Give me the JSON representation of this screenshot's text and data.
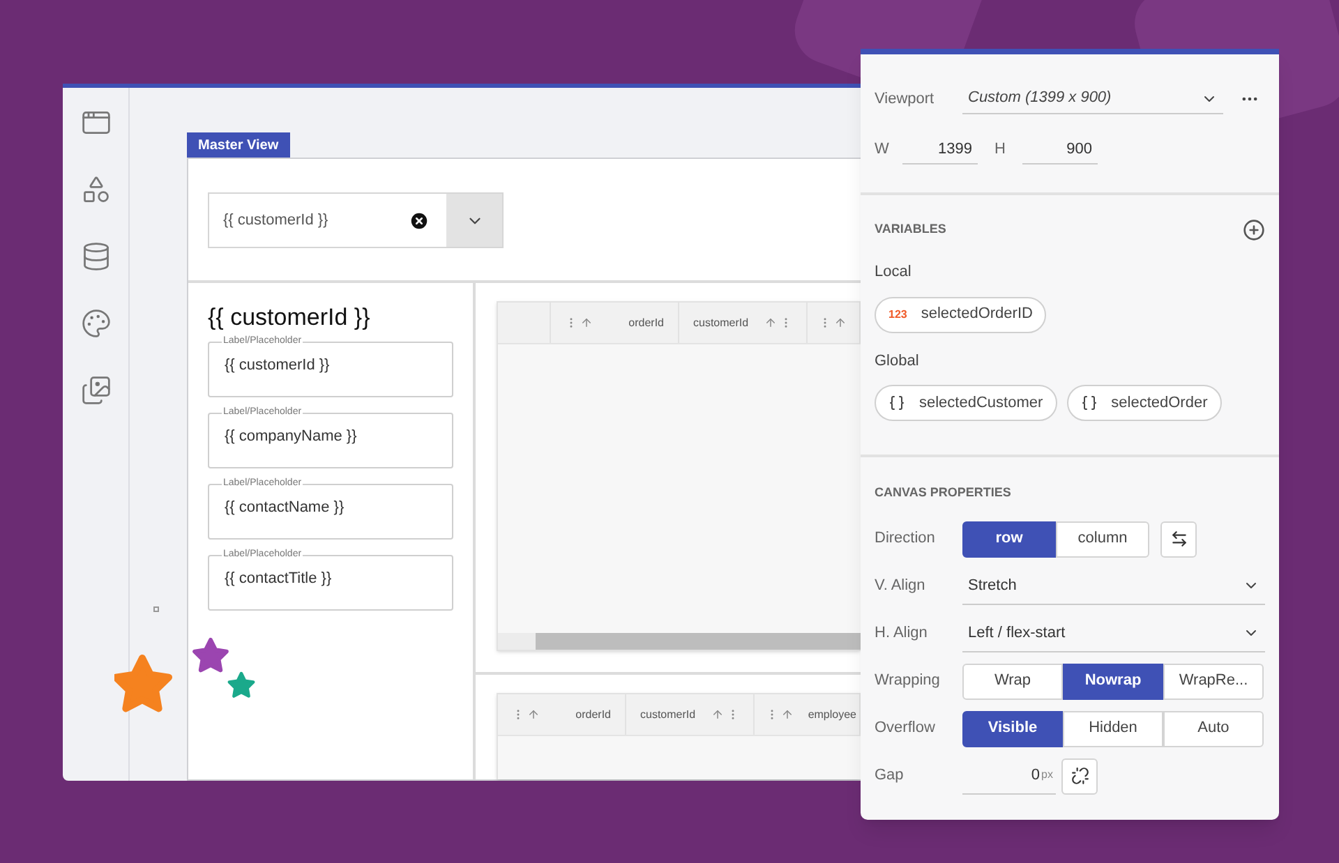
{
  "sidebar": {
    "items": [
      {
        "kind": "screens"
      },
      {
        "kind": "components"
      },
      {
        "kind": "data"
      },
      {
        "kind": "theme"
      },
      {
        "kind": "assets"
      }
    ]
  },
  "canvas": {
    "tab": "Master View",
    "combo": {
      "value": "{{ customerId }}"
    },
    "detail": {
      "title": "{{ customerId }}",
      "fields": [
        {
          "label": "Label/Placeholder",
          "value": "{{ customerId }}"
        },
        {
          "label": "Label/Placeholder",
          "value": "{{ companyName }}"
        },
        {
          "label": "Label/Placeholder",
          "value": "{{ contactName }}"
        },
        {
          "label": "Label/Placeholder",
          "value": "{{ contactTitle }}"
        }
      ]
    },
    "grids": [
      {
        "columns": [
          {
            "kind": "blank"
          },
          {
            "kind": "icons_left",
            "label": "orderId"
          },
          {
            "kind": "icons_right",
            "label": "customerId"
          },
          {
            "kind": "icons_left"
          }
        ],
        "scrollbar": true
      },
      {
        "columns": [
          {
            "kind": "icons_left",
            "label": "orderId"
          },
          {
            "kind": "icons_right",
            "label": "customerId"
          },
          {
            "kind": "icons_left",
            "label": "employee"
          }
        ],
        "scrollbar": false
      }
    ]
  },
  "properties_panel": {
    "viewport": {
      "label": "Viewport",
      "value": "Custom (1399 x 900)"
    },
    "size": [
      {
        "label": "W",
        "value": "1399"
      },
      {
        "label": "H",
        "value": "900"
      }
    ],
    "variables": {
      "heading": "VARIABLES",
      "groups": [
        {
          "label": "Local",
          "items": [
            {
              "kind": "number",
              "badge": "123",
              "name": "selectedOrderID"
            }
          ]
        },
        {
          "label": "Global",
          "items": [
            {
              "kind": "object",
              "name": "selectedCustomer"
            },
            {
              "kind": "object",
              "name": "selectedOrder"
            }
          ]
        }
      ]
    },
    "canvas_properties": {
      "heading": "CANVAS PROPERTIES",
      "rows": [
        {
          "kind": "toggle_swap",
          "label": "Direction",
          "options": [
            {
              "label": "row",
              "selected": true
            },
            {
              "label": "column",
              "selected": false
            }
          ]
        },
        {
          "kind": "select",
          "label": "V. Align",
          "value": "Stretch"
        },
        {
          "kind": "select",
          "label": "H. Align",
          "value": "Left / flex-start"
        },
        {
          "kind": "toggle",
          "label": "Wrapping",
          "options": [
            {
              "label": "Wrap",
              "selected": false
            },
            {
              "label": "Nowrap",
              "selected": true
            },
            {
              "label": "WrapRe...",
              "selected": false
            }
          ]
        },
        {
          "kind": "toggle",
          "label": "Overflow",
          "options": [
            {
              "label": "Visible",
              "selected": true
            },
            {
              "label": "Hidden",
              "selected": false
            },
            {
              "label": "Auto",
              "selected": false
            }
          ]
        },
        {
          "kind": "number",
          "label": "Gap",
          "value": "0",
          "unit": "px"
        }
      ]
    }
  }
}
